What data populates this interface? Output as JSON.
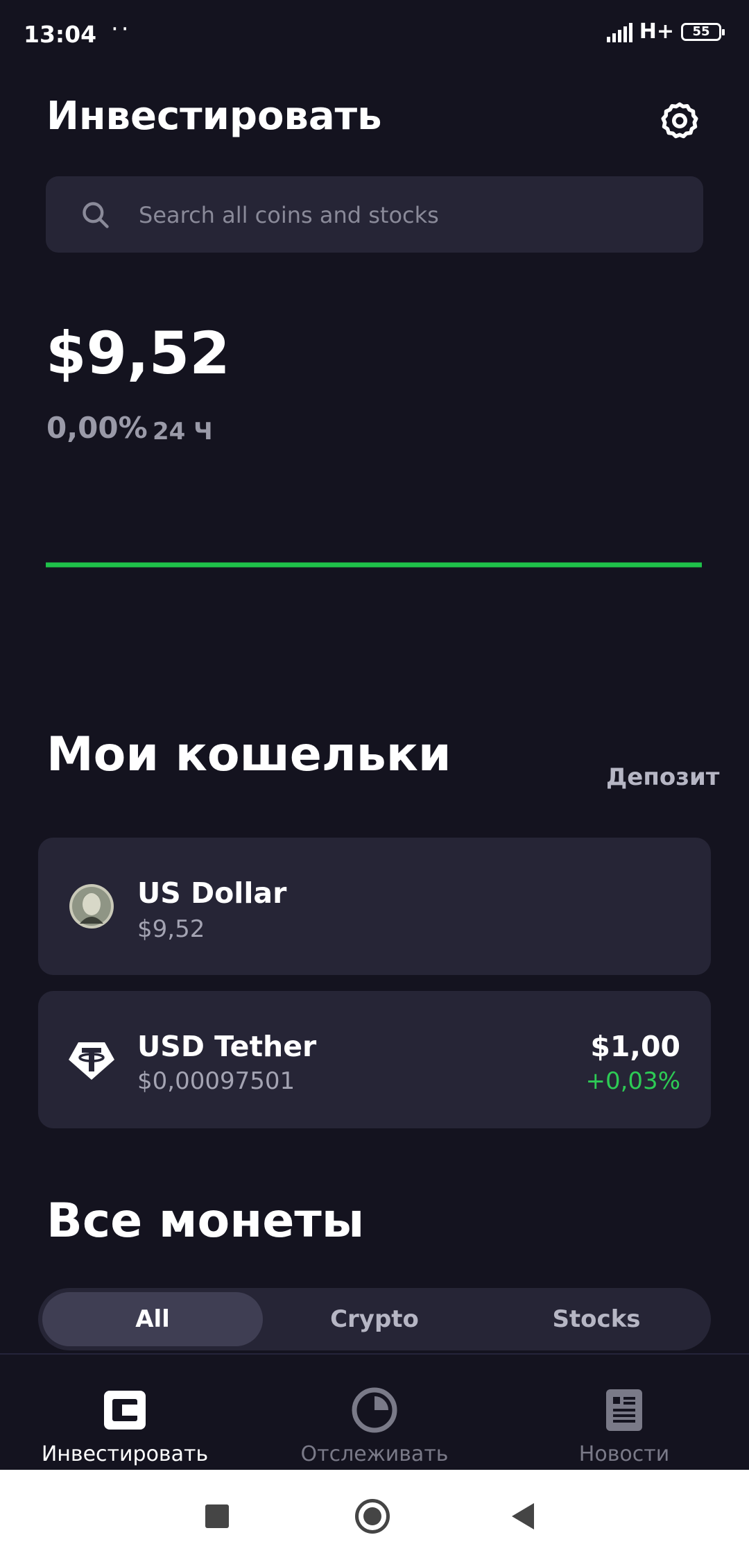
{
  "status_bar": {
    "time": "13:04",
    "dots": "··",
    "network": "H+",
    "battery": "55"
  },
  "header": {
    "title": "Инвестировать",
    "settings_icon": "gear-icon"
  },
  "search": {
    "placeholder": "Search all coins and stocks",
    "icon": "search-icon"
  },
  "portfolio": {
    "balance": "$9,52",
    "change": "0,00%",
    "period": "24 Ч"
  },
  "chart_data": {
    "type": "line",
    "values": [
      9.52,
      9.52
    ],
    "color": "#1fc24a"
  },
  "wallets": {
    "title": "Мои кошельки",
    "deposit_label": "Депозит",
    "items": [
      {
        "name": "US Dollar",
        "balance": "$9,52",
        "icon": "dollar-coin-icon"
      },
      {
        "name": "USD Tether",
        "balance": "$0,00097501",
        "price": "$1,00",
        "change": "+0,03%",
        "icon": "tether-icon"
      }
    ]
  },
  "all_coins": {
    "title": "Все монеты",
    "tabs": [
      {
        "label": "All",
        "selected": true
      },
      {
        "label": "Crypto",
        "selected": false
      },
      {
        "label": "Stocks",
        "selected": false
      }
    ]
  },
  "bottom_nav": {
    "items": [
      {
        "label": "Инвестировать",
        "icon": "wallet-icon",
        "active": true
      },
      {
        "label": "Отслеживать",
        "icon": "pie-chart-icon",
        "active": false
      },
      {
        "label": "Новости",
        "icon": "news-icon",
        "active": false
      }
    ]
  },
  "colors": {
    "background": "#14131f",
    "card": "#262536",
    "positive": "#2dcb55",
    "chart_line": "#1fc24a"
  }
}
